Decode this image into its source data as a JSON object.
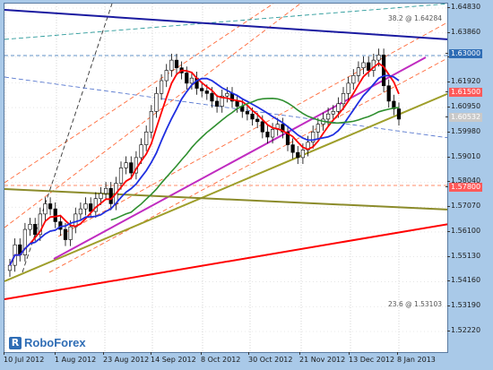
{
  "watermark": "RoboForex",
  "y_axis": {
    "ticks": [
      "1.64830",
      "1.63860",
      "1.62920",
      "1.61920",
      "1.60950",
      "1.59980",
      "1.59010",
      "1.58040",
      "1.57070",
      "1.56100",
      "1.55130",
      "1.54160",
      "1.53190",
      "1.52220"
    ],
    "tick_values": [
      1.6483,
      1.6386,
      1.6292,
      1.6192,
      1.6095,
      1.5998,
      1.5901,
      1.5804,
      1.5707,
      1.561,
      1.5513,
      1.5416,
      1.5319,
      1.5222
    ],
    "highlights": [
      {
        "label": "1.63000",
        "value": 1.63,
        "bg": "#2f6db5",
        "fg": "#ffffff"
      },
      {
        "label": "1.61500",
        "value": 1.615,
        "bg": "#ff5a5a",
        "fg": "#ffffff"
      },
      {
        "label": "1.60532",
        "value": 1.60532,
        "bg": "#c9c9c9",
        "fg": "#ffffff"
      },
      {
        "label": "1.57800",
        "value": 1.578,
        "bg": "#ff5a5a",
        "fg": "#ffffff"
      }
    ]
  },
  "x_axis": {
    "ticks": [
      "10 Jul 2012",
      "1 Aug 2012",
      "23 Aug 2012",
      "14 Sep 2012",
      "8 Oct 2012",
      "30 Oct 2012",
      "21 Nov 2012",
      "13 Dec 2012",
      "8 Jan 2013"
    ]
  },
  "annotations": {
    "fib_top": "38.2 @ 1.64284",
    "fib_bottom": "23.6 @ 1.53103"
  },
  "colors": {
    "bull_candle": "#ffffff",
    "bear_candle": "#000000",
    "ma_red": "#ff0000",
    "ma_blue": "#1f2fe0",
    "ma_green": "#2f8f2f",
    "ma_olive": "#8b8b2a",
    "trend_magenta": "#c02cc0",
    "trend_olive": "#9e9e2a",
    "channel_navy": "#1a1aa0",
    "support_red": "#ff0000"
  },
  "chart_data": {
    "type": "line",
    "series": [
      {
        "values": [
          1.548,
          1.556,
          1.552,
          1.562,
          1.564,
          1.56,
          1.568,
          1.572,
          1.57,
          1.565,
          1.562,
          1.558,
          1.563,
          1.568,
          1.57,
          1.572,
          1.569,
          1.574,
          1.576,
          1.578,
          1.572,
          1.58,
          1.586,
          1.588,
          1.584,
          1.59,
          1.595,
          1.6,
          1.608,
          1.615,
          1.62,
          1.624,
          1.628,
          1.625,
          1.623,
          1.619,
          1.621,
          1.617,
          1.616,
          1.615,
          1.612,
          1.61,
          1.614,
          1.615,
          1.612,
          1.61,
          1.608,
          1.607,
          1.605,
          1.604,
          1.6,
          1.598,
          1.601,
          1.603,
          1.6,
          1.595,
          1.592,
          1.59,
          1.593,
          1.596,
          1.6,
          1.603,
          1.605,
          1.607,
          1.608,
          1.611,
          1.615,
          1.619,
          1.622,
          1.625,
          1.627,
          1.624,
          1.628,
          1.63,
          1.618,
          1.612,
          1.609,
          1.605
        ]
      }
    ]
  }
}
